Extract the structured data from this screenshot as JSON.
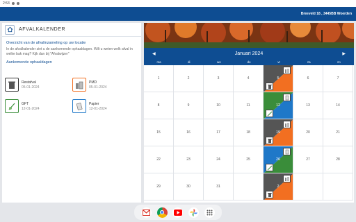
{
  "statusbar": {
    "time": "2:53"
  },
  "appbar": {
    "address": "Breeveld 18 , 3445BB Woerden"
  },
  "left": {
    "title": "AFVALKALENDER",
    "subtitle": "Overzicht van de afvalinzameling op uw locatie",
    "intro": "In de afvalkalender ziet u de aankomende ophaaldagen. Wilt u weten welk afval in welke bak mag? Kijk dan bij \"Afvalwijzer\"",
    "section": "Aankomende ophaaldagen",
    "items": [
      {
        "name": "Restafval",
        "date": "05-01-2024",
        "icon": "restafval-bin-icon",
        "color": "#444444"
      },
      {
        "name": "PMD",
        "date": "05-01-2024",
        "icon": "pmd-bin-icon",
        "color": "#f26f21"
      },
      {
        "name": "GFT",
        "date": "12-01-2024",
        "icon": "gft-bin-icon",
        "color": "#3a8d3a"
      },
      {
        "name": "Papier",
        "date": "12-01-2024",
        "icon": "papier-bin-icon",
        "color": "#1f78c8"
      }
    ]
  },
  "calendar": {
    "month": "Januari 2024",
    "prev": "◀",
    "next": "▶",
    "days": [
      "ma",
      "di",
      "wo",
      "do",
      "vr",
      "za",
      "zo"
    ],
    "weeks": [
      [
        "1",
        "2",
        "3",
        "4",
        "5",
        "6",
        "7"
      ],
      [
        "8",
        "9",
        "10",
        "11",
        "12",
        "13",
        "14"
      ],
      [
        "15",
        "16",
        "17",
        "18",
        "19",
        "20",
        "21"
      ],
      [
        "22",
        "23",
        "24",
        "25",
        "26",
        "27",
        "28"
      ],
      [
        "29",
        "30",
        "31",
        "",
        "2",
        "",
        ""
      ]
    ]
  },
  "colors": {
    "brand": "#0e4d92",
    "rest": "#555555",
    "pmd": "#f26f21",
    "gft": "#3a8d3a",
    "papier": "#1f78c8"
  },
  "dock": [
    "gmail-icon",
    "chrome-icon",
    "youtube-icon",
    "photos-icon",
    "app-drawer-icon"
  ]
}
